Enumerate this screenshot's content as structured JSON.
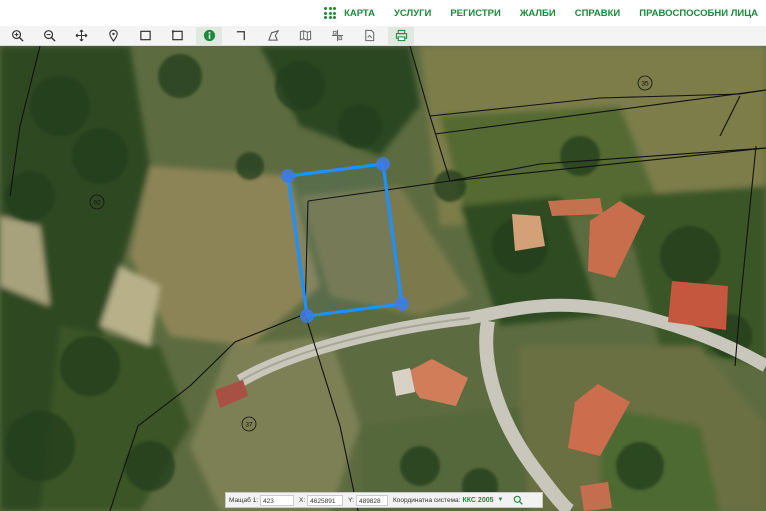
{
  "nav": {
    "items": [
      {
        "label": "КАРТА"
      },
      {
        "label": "УСЛУГИ"
      },
      {
        "label": "РЕГИСТРИ"
      },
      {
        "label": "ЖАЛБИ"
      },
      {
        "label": "СПРАВКИ"
      },
      {
        "label": "ПРАВОСПОСОБНИ ЛИЦА"
      }
    ],
    "icon": "apps-grid-icon"
  },
  "toolbar": {
    "tools": [
      {
        "icon": "zoom-in-icon"
      },
      {
        "icon": "zoom-out-icon"
      },
      {
        "icon": "pan-icon"
      },
      {
        "icon": "location-pin-icon"
      },
      {
        "icon": "select-rectangle-icon"
      },
      {
        "icon": "select-area-icon"
      },
      {
        "icon": "info-icon",
        "active": true
      },
      {
        "icon": "measure-distance-icon"
      },
      {
        "icon": "measure-area-icon"
      },
      {
        "icon": "map-layers-icon"
      },
      {
        "icon": "coordinates-icon"
      },
      {
        "icon": "document-icon"
      },
      {
        "icon": "print-icon"
      }
    ]
  },
  "map": {
    "parcel_labels": [
      "92",
      "37",
      "35"
    ],
    "colors": {
      "selection": "#1e90ff",
      "boundaries": "#111111",
      "accent": "#1b8a3a"
    }
  },
  "statusbar": {
    "scale_label": "Мащаб 1:",
    "scale_value": "423",
    "x_label": "X:",
    "x_value": "4625891",
    "y_label": "Y:",
    "y_value": "489828",
    "system_label": "Координатна система:",
    "system_value": "ККС 2005"
  }
}
